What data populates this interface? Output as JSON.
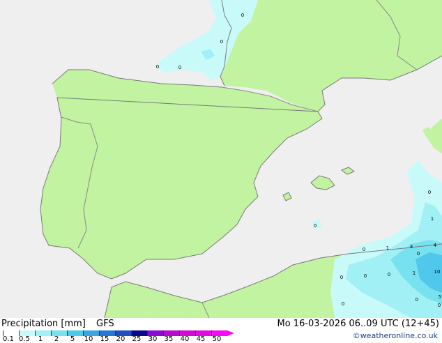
{
  "footer": {
    "title": "Precipitation [mm]",
    "model": "GFS",
    "datetime": "Mo 16-03-2026 06..09 UTC (12+45)",
    "credit": "©weatheronline.co.uk"
  },
  "legend": {
    "ticks": [
      "0.1",
      "0.5",
      "1",
      "2",
      "5",
      "10",
      "15",
      "20",
      "25",
      "30",
      "35",
      "40",
      "45",
      "50"
    ],
    "colors": [
      "#ffffff",
      "#c8fafa",
      "#a0f0f5",
      "#78e1f0",
      "#50c8eb",
      "#3ca5e1",
      "#2878d2",
      "#1e50be",
      "#0a0a8c",
      "#8c0ad2",
      "#b40ad2",
      "#d20ad2",
      "#e10ae1",
      "#f50af5"
    ]
  },
  "map": {
    "colors": {
      "sea": "#efefef",
      "land": "#c1f3a0",
      "border": "#8a8a8a",
      "coast": "#7a7a7a"
    },
    "contour_labels": [
      "0",
      "0",
      "0",
      "0",
      "0",
      "0",
      "0",
      "1",
      "0",
      "1",
      "3",
      "4",
      "1",
      "10",
      "0",
      "0",
      "0",
      "0",
      "0",
      "0",
      "5"
    ]
  }
}
